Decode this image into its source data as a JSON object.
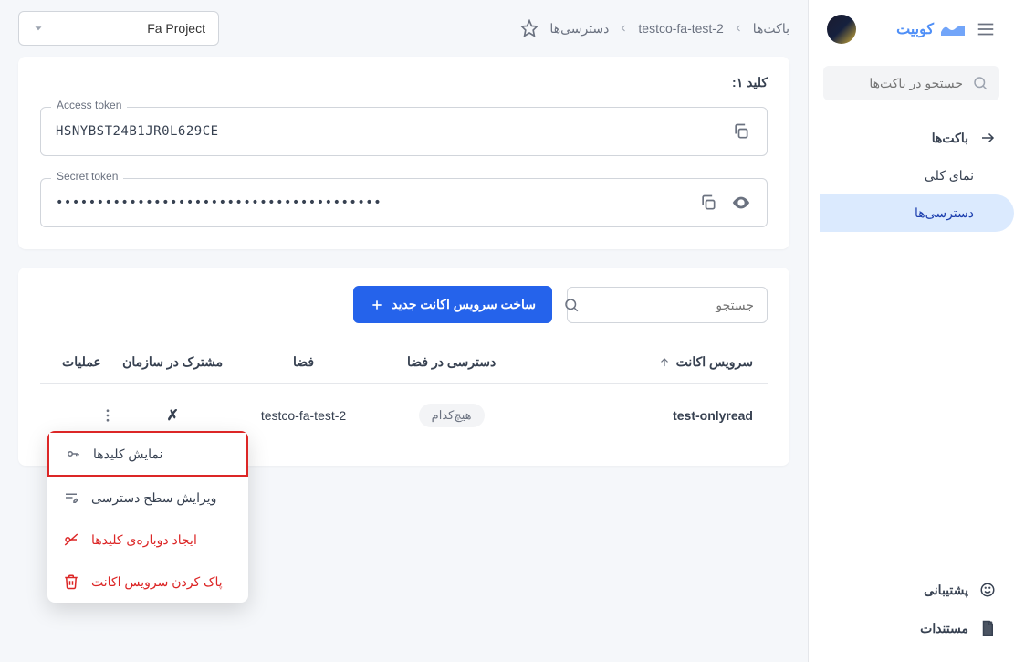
{
  "brand": {
    "name": "کوبیت"
  },
  "sidebar": {
    "search_placeholder": "جستجو در باکت‌ها",
    "nav": {
      "buckets": "باکت‌ها",
      "overview": "نمای کلی",
      "access": "دسترسی‌ها"
    },
    "footer": {
      "support": "پشتیبانی",
      "docs": "مستندات"
    }
  },
  "breadcrumb": {
    "root": "باکت‌ها",
    "bucket": "testco-fa-test-2",
    "page": "دسترسی‌ها"
  },
  "project": {
    "label": "Fa Project"
  },
  "key_card": {
    "title": "کلید ۱:",
    "access_label": "Access token",
    "access_value": "HSNYBST24B1JR0L629CE",
    "secret_label": "Secret token",
    "secret_value": "••••••••••••••••••••••••••••••••••••••••"
  },
  "sa_section": {
    "search_placeholder": "جستجو",
    "create_btn": "ساخت سرویس اکانت جدید",
    "cols": {
      "service_account": "سرویس اکانت",
      "access": "دسترسی در فضا",
      "space": "فضا",
      "shared": "مشترک در سازمان",
      "ops": "عملیات"
    },
    "rows": [
      {
        "name": "test-onlyread",
        "access_badge": "هیچ‌کدام",
        "space": "testco-fa-test-2",
        "shared": "✗"
      }
    ],
    "menu": {
      "show_keys": "نمایش کلیدها",
      "edit_access": "ویرایش سطح دسترسی",
      "regen_keys": "ایجاد دوباره‌ی کلیدها",
      "delete": "پاک کردن سرویس اکانت"
    }
  }
}
